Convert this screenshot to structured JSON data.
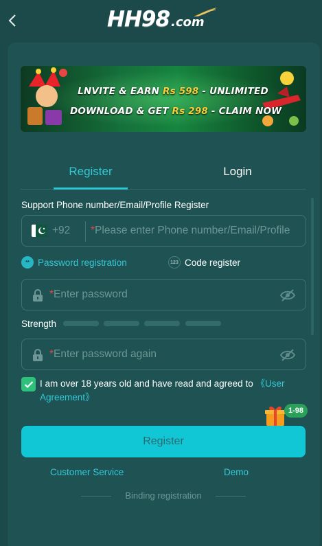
{
  "header": {
    "brand": "HH98",
    "brand_suffix": ".com"
  },
  "banner": {
    "line1_prefix": "LNVITE & EARN ",
    "line1_amount": "Rs 598",
    "line1_suffix": " - UNLIMITED",
    "line2_prefix": "DOWNLOAD & GET ",
    "line2_amount": "Rs 298",
    "line2_suffix": " - CLAIM NOW"
  },
  "tabs": [
    {
      "label": "Register",
      "active": true
    },
    {
      "label": "Login",
      "active": false
    }
  ],
  "form": {
    "account_label": "Support Phone number/Email/Profile Register",
    "country_code": "+92",
    "account_placeholder": "Please enter Phone number/Email/Profile",
    "mode_password": "Password registration",
    "mode_password_icon_text": "**",
    "mode_code": "Code register",
    "mode_code_icon_text": "123",
    "password_placeholder": "Enter password",
    "strength_label": "Strength",
    "strength_level": 0,
    "confirm_placeholder": "Enter password again",
    "agreement_text": "I am over 18 years old and have read and agreed to ",
    "agreement_link": "《User Agreement》",
    "agreed": true,
    "gift_badge": "1-98",
    "submit_label": "Register"
  },
  "footer": {
    "customer_service": "Customer Service",
    "demo": "Demo",
    "binding": "Binding registration"
  },
  "colors": {
    "background": "#1c4a4a",
    "panel": "#1f5353",
    "accent": "#11c7d5",
    "checkbox": "#2ec17b",
    "required": "#e84545",
    "banner_highlight": "#f7d23a"
  }
}
